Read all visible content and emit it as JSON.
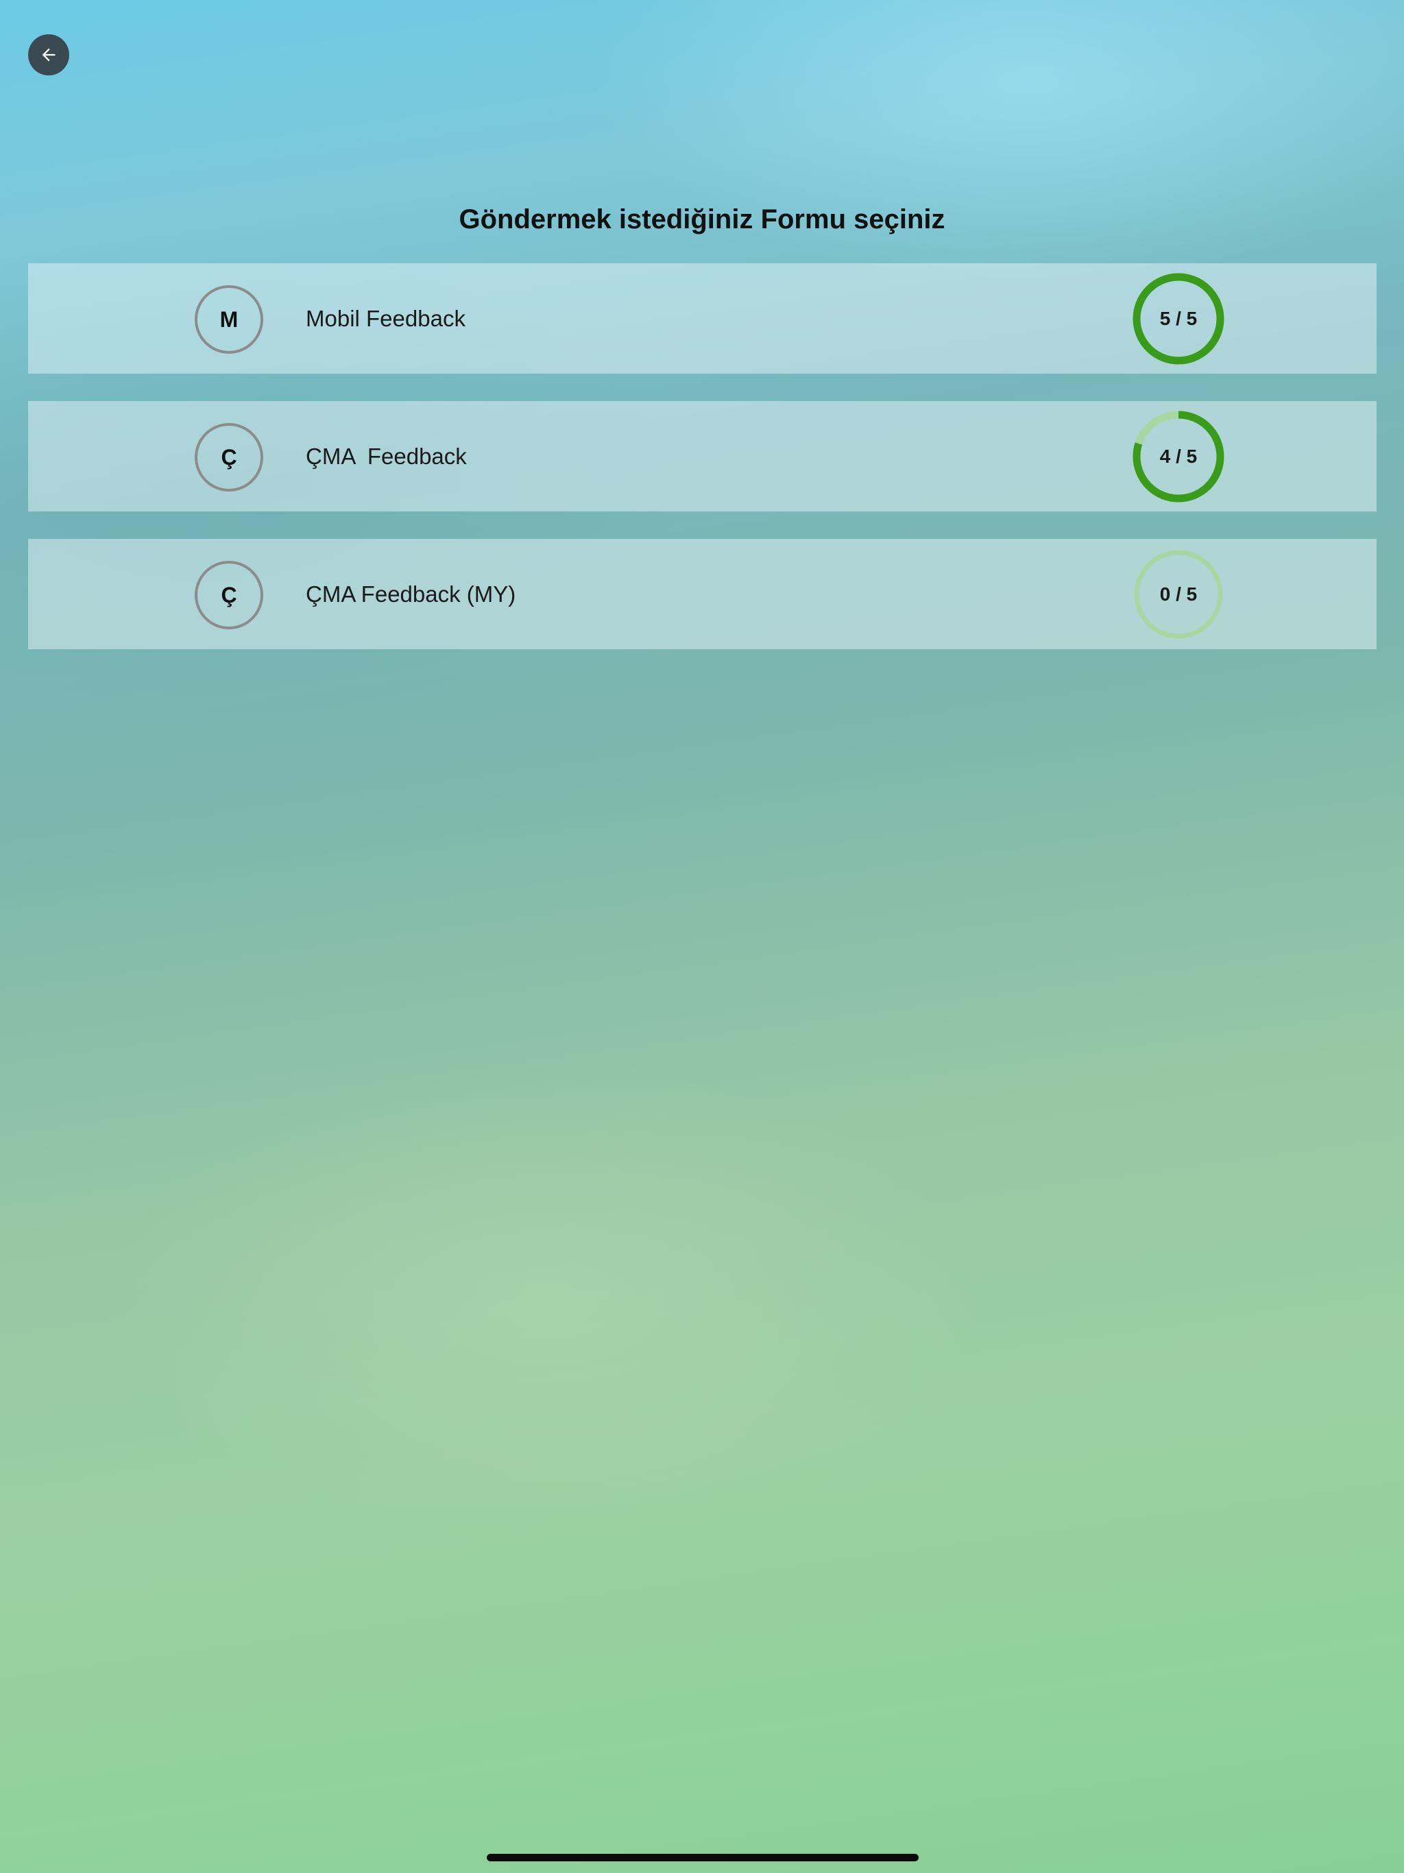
{
  "header": {
    "back_icon": "arrow-left-icon",
    "title": "Göndermek istediğiniz Formu seçiniz"
  },
  "forms": [
    {
      "initial": "M",
      "name": "Mobil Feedback",
      "progress_text": "5 / 5",
      "completed": 5,
      "total": 5
    },
    {
      "initial": "Ç",
      "name": "ÇMA  Feedback",
      "progress_text": "4 / 5",
      "completed": 4,
      "total": 5
    },
    {
      "initial": "Ç",
      "name": "ÇMA Feedback (MY)",
      "progress_text": "0 / 5",
      "completed": 0,
      "total": 5
    }
  ],
  "colors": {
    "progress_fill": "#3a9a1a",
    "progress_track": "#a9d7a2",
    "back_button": "#3b4a52"
  }
}
